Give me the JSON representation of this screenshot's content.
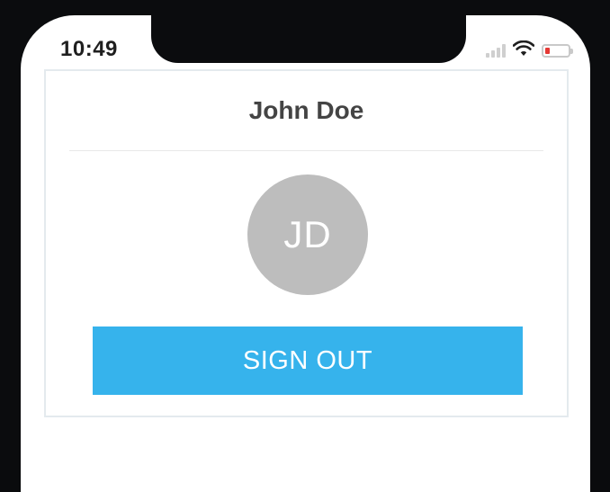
{
  "status_bar": {
    "time": "10:49",
    "icons": [
      "cellular-signal-icon",
      "wifi-icon",
      "battery-low-icon"
    ]
  },
  "profile": {
    "name": "John Doe",
    "initials": "JD",
    "sign_out_label": "SIGN OUT"
  },
  "colors": {
    "accent": "#36b3ec",
    "avatar_bg": "#bdbdbd",
    "battery_low": "#e53935"
  }
}
